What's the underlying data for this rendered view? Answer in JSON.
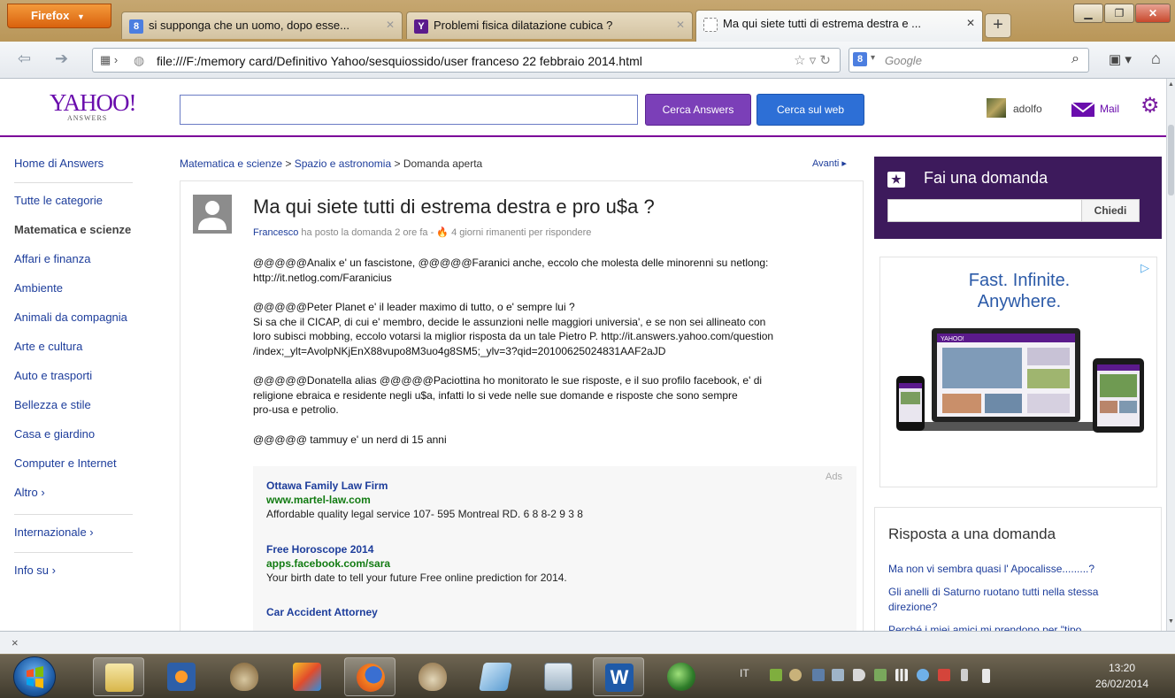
{
  "browser": {
    "menu_button": "Firefox",
    "tabs": [
      {
        "title": "si supponga che un uomo, dopo esse...",
        "favicon": "8"
      },
      {
        "title": "Problemi fisica dilatazione cubica ?",
        "favicon": "Y"
      },
      {
        "title": "Ma qui siete tutti di estrema destra e ...",
        "favicon": ""
      }
    ],
    "new_tab": "+",
    "url": "file:///F:/memory card/Definitivo Yahoo/sesquiossido/user franceso 22 febbraio 2014.html",
    "search_placeholder": "Google",
    "search_engine_badge": "8",
    "status_close": "×"
  },
  "header": {
    "logo_main": "YAHOO!",
    "logo_sub": "ANSWERS",
    "search_answers_button": "Cerca Answers",
    "search_web_button": "Cerca sul web",
    "username": "adolfo",
    "mail_label": "Mail"
  },
  "leftnav": {
    "home": "Home di Answers",
    "categories": "Tutte le categorie",
    "current": "Matematica e scienze",
    "items": [
      "Affari e finanza",
      "Ambiente",
      "Animali da compagnia",
      "Arte e cultura",
      "Auto e trasporti",
      "Bellezza e stile",
      "Casa e giardino",
      "Computer e Internet"
    ],
    "altro": "Altro  ›",
    "internazionale": "Internazionale  ›",
    "info": "Info su  ›"
  },
  "breadcrumb": {
    "crumb1": "Matematica e scienze",
    "crumb2": "Spazio e astronomia",
    "sep": " > ",
    "current": "Domanda aperta",
    "next": "Avanti ▸"
  },
  "question": {
    "title": "Ma qui siete tutti di estrema destra e pro u$a ?",
    "author": "Francesco",
    "meta": " ha posto la domanda 2 ore fa - ",
    "remaining": "4 giorni rimanenti per rispondere",
    "paragraphs": [
      "@@@@@Analix e' un fascistone, @@@@@Faranici anche, eccolo che molesta delle minorenni su netlong:\nhttp://it.netlog.com/Faranicius",
      "@@@@@Peter Planet e' il leader maximo di tutto, o e' sempre lui ?\nSi sa che il CICAP, di cui e' membro, decide le assunzioni nelle maggiori universia', e se non sei allineato con\nloro subisci mobbing, eccolo votarsi la miglior risposta da un tale Pietro P. http://it.answers.yahoo.com/question\n/index;_ylt=AvolpNKjEnX88vupo8M3uo4g8SM5;_ylv=3?qid=20100625024831AAF2aJD",
      "@@@@@Donatella alias @@@@@Paciottina ho monitorato le sue risposte, e il suo profilo facebook, e' di\nreligione ebraica e residente negli u$a, infatti lo si vede nelle sue domande e risposte che sono sempre\npro-usa e petrolio.",
      "@@@@@ tammuy e' un nerd di 15 anni"
    ]
  },
  "ads": {
    "label": "Ads",
    "items": [
      {
        "title": "Ottawa Family Law Firm",
        "url": "www.martel-law.com",
        "desc": "Affordable quality legal service 107- 595 Montreal RD. 6 8 8-2 9 3 8"
      },
      {
        "title": "Free Horoscope 2014",
        "url": "apps.facebook.com/sara",
        "desc": "Your birth date to tell your future Free online prediction for 2014."
      },
      {
        "title": "Car Accident Attorney",
        "url": "",
        "desc": ""
      }
    ]
  },
  "ask": {
    "title": "Fai una domanda",
    "button": "Chiedi"
  },
  "display_ad": {
    "headline_1": "Fast. Infinite.",
    "headline_2": "Anywhere.",
    "laptop_logo": "YAHOO!"
  },
  "answer_box": {
    "title": "Risposta a una domanda",
    "items": [
      "Ma non vi sembra quasi l' Apocalisse.........?",
      "Gli anelli di Saturno ruotano tutti nella stessa direzione?",
      "Perché i miei amici mi prendono per \"tipo"
    ]
  },
  "taskbar": {
    "language": "IT",
    "time": "13:20",
    "date": "26/02/2014"
  },
  "colors": {
    "yahoo_purple": "#6a0dad",
    "answers_button": "#7b3fb8",
    "web_button": "#2d6fd6",
    "ask_box": "#3d1a5c",
    "link_blue": "#1d3d9b",
    "ad_green": "#127b12"
  }
}
